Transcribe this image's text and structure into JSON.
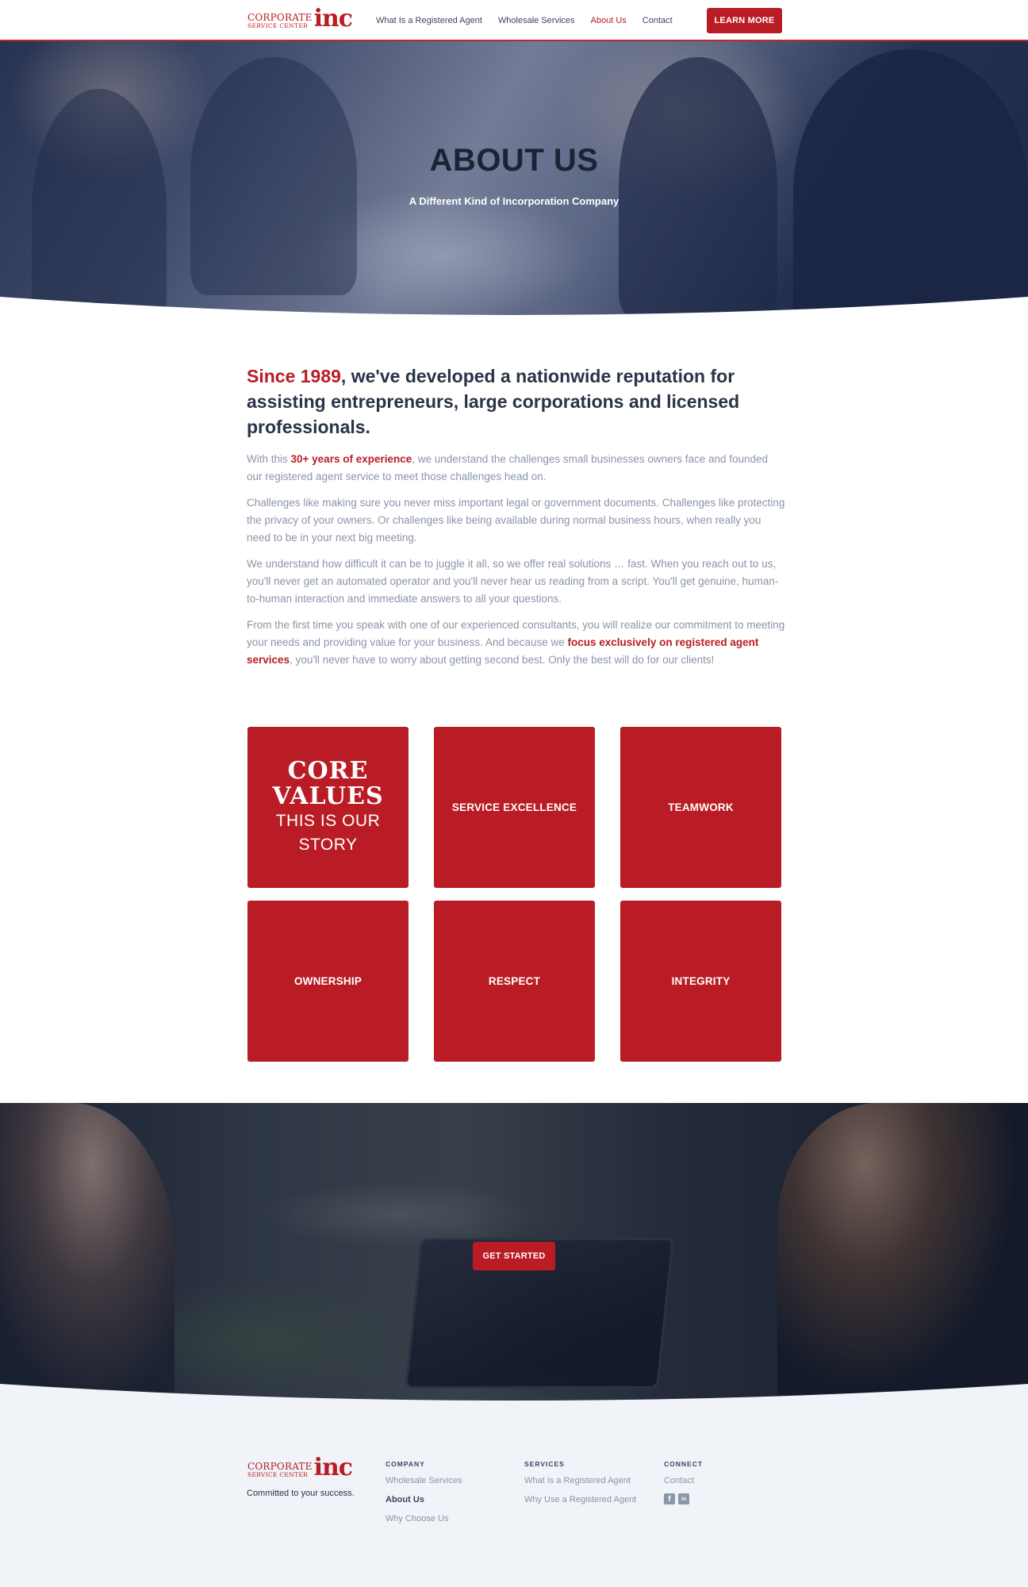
{
  "brand": {
    "logo_line1": "CORPORATE",
    "logo_line2": "SERVICE CENTER",
    "logo_mark": "inc",
    "tagline": "Committed to your success."
  },
  "nav": {
    "links": [
      {
        "label": "What Is a Registered Agent",
        "active": false
      },
      {
        "label": "Wholesale Services",
        "active": false
      },
      {
        "label": "About Us",
        "active": true
      },
      {
        "label": "Contact",
        "active": false
      }
    ],
    "cta": "LEARN MORE"
  },
  "hero": {
    "title": "ABOUT US",
    "subtitle": "A Different Kind of Incorporation Company"
  },
  "intro": {
    "highlight": "Since 1989",
    "text": ", we've developed a nationwide reputation for assisting entrepreneurs, large corporations and licensed professionals."
  },
  "paragraphs": {
    "p1_pre": "With this ",
    "p1_hl": "30+ years of experience",
    "p1_post": ", we understand the challenges small businesses owners face and founded our registered agent service to meet those challenges head on.",
    "p2": "Challenges like making sure you never miss important legal or government documents. Challenges like protecting the privacy of your owners. Or challenges like being available during normal business hours, when really you need to be in your next big meeting.",
    "p3": "We understand how difficult it can be to juggle it all, so we offer real solutions … fast. When you reach out to us, you'll never get an automated operator and you'll never hear us reading from a script. You'll get genuine, human-to-human interaction and immediate answers to all your questions.",
    "p4_pre": "From the first time you speak with one of our experienced consultants, you will realize our commitment to meeting your needs and providing value for your business. And because we ",
    "p4_hl": "focus exclusively on registered agent services",
    "p4_post": ", you'll never have to worry about getting second best. Only the best will do for our clients!"
  },
  "values": {
    "heading_line1": "CORE",
    "heading_line2": "VALUES",
    "story_line1": "THIS IS OUR",
    "story_line2": "STORY",
    "items": [
      "SERVICE EXCELLENCE",
      "TEAMWORK",
      "OWNERSHIP",
      "RESPECT",
      "INTEGRITY"
    ]
  },
  "banner": {
    "cta": "GET STARTED"
  },
  "footer": {
    "columns": [
      {
        "heading": "COMPANY",
        "links": [
          {
            "label": "Wholesale Services",
            "strong": false
          },
          {
            "label": "About Us",
            "strong": true
          },
          {
            "label": "Why Choose Us",
            "strong": false
          }
        ]
      },
      {
        "heading": "SERVICES",
        "links": [
          {
            "label": "What Is a Registered Agent",
            "strong": false
          },
          {
            "label": "Why Use a Registered Agent",
            "strong": false
          }
        ]
      },
      {
        "heading": "CONNECT",
        "links": [
          {
            "label": "Contact",
            "strong": false
          }
        ]
      }
    ],
    "social": [
      {
        "icon": "facebook-icon",
        "glyph": "f"
      },
      {
        "icon": "linkedin-icon",
        "glyph": "in"
      }
    ]
  },
  "colors": {
    "brand_red": "#b91c24",
    "text_dark": "#2a3447",
    "text_muted": "#8a95a8",
    "footer_bg": "#f0f3f7"
  }
}
